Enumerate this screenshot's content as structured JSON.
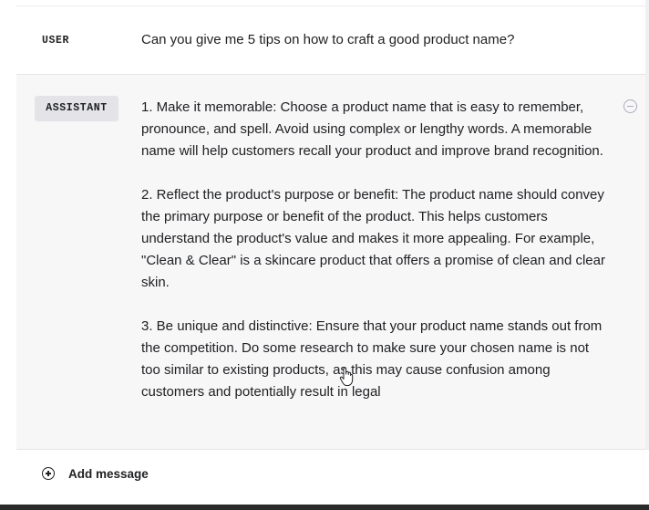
{
  "user_message": {
    "role": "USER",
    "text": "Can you give me 5 tips on how to craft a good product name?"
  },
  "assistant_message": {
    "role": "ASSISTANT",
    "paragraphs": [
      "1. Make it memorable: Choose a product name that is easy to remember, pronounce, and spell. Avoid using complex or lengthy words. A memorable name will help customers recall your product and improve brand recognition.",
      "2. Reflect the product's purpose or benefit: The product name should convey the primary purpose or benefit of the product. This helps customers understand the product's value and makes it more appealing. For example, \"Clean & Clear\" is a skincare product that offers a promise of clean and clear skin.",
      "3. Be unique and distinctive: Ensure that your product name stands out from the competition. Do some research to make sure your chosen name is not too similar to existing products, as this may cause confusion among customers and potentially result in legal"
    ],
    "remove_icon": "minus-circle-icon"
  },
  "composer": {
    "add_message_label": "Add message",
    "add_icon": "plus-circle-icon"
  }
}
